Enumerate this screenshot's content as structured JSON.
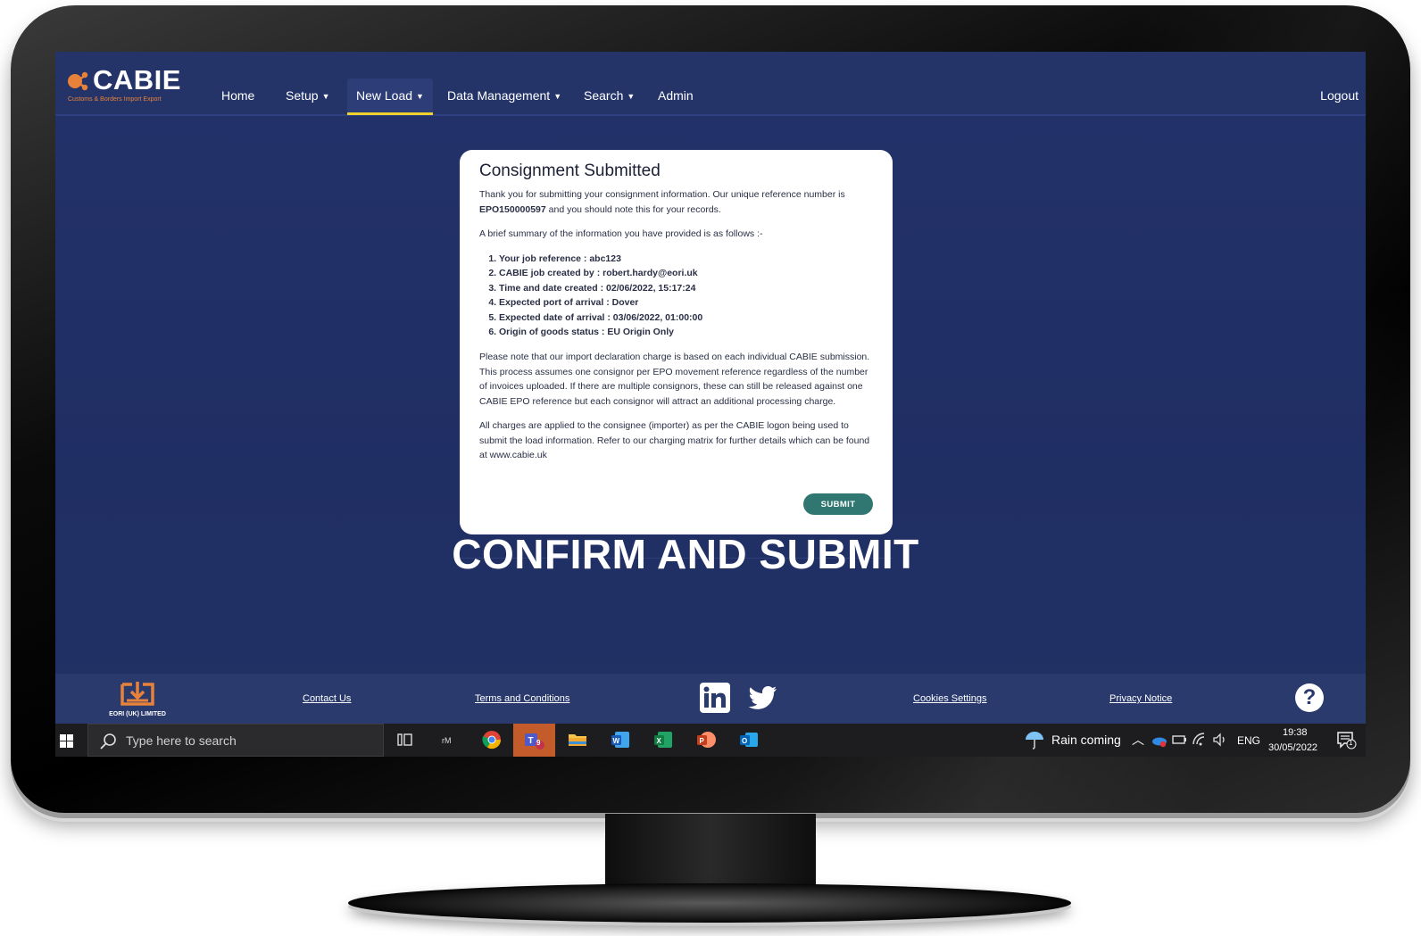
{
  "app": {
    "logo_text": "CABIE",
    "logo_subtitle": "Customs & Borders Import Export"
  },
  "nav": {
    "items": [
      {
        "label": "Home",
        "dropdown": false
      },
      {
        "label": "Setup",
        "dropdown": true
      },
      {
        "label": "New Load",
        "dropdown": true,
        "active": true
      },
      {
        "label": "Data Management",
        "dropdown": true
      },
      {
        "label": "Search",
        "dropdown": true
      },
      {
        "label": "Admin",
        "dropdown": false
      }
    ],
    "logout": "Logout"
  },
  "card": {
    "title": "Consignment Submitted",
    "intro_before": "Thank you for submitting your consignment information. Our unique reference number is ",
    "reference": "EPO150000597",
    "intro_after": " and you should note this for your records.",
    "summary_intro": "A brief summary of the information you have provided is as follows :-",
    "summary_items": [
      "Your job reference : abc123",
      "CABIE job created by : robert.hardy@eori.uk",
      "Time and date created : 02/06/2022, 15:17:24",
      "Expected port of arrival : Dover",
      "Expected date of arrival : 03/06/2022, 01:00:00",
      "Origin of goods status : EU Origin Only"
    ],
    "note_1": "Please note that our import declaration charge is based on each individual CABIE submission. This process assumes one consignor per EPO movement reference regardless of the number of invoices uploaded. If there are multiple consignors, these can still be released against one CABIE EPO reference but each consignor will attract an additional processing charge.",
    "note_2": "All charges are applied to the consignee (importer) as per the CABIE logon being used to submit the load information. Refer to our charging matrix for further details which can be found at www.cabie.uk",
    "submit_label": "SUBMIT"
  },
  "caption": "CONFIRM AND SUBMIT",
  "footer": {
    "logo_label": "EORI (UK) LIMITED",
    "links": {
      "contact": "Contact Us",
      "terms": "Terms and Conditions",
      "cookies": "Cookies Settings",
      "privacy": "Privacy Notice"
    },
    "social_icons": [
      "linkedin-icon",
      "twitter-icon"
    ],
    "help": "?"
  },
  "taskbar": {
    "search_placeholder": "Type here to search",
    "weather": "Rain coming",
    "language": "ENG",
    "time": "19:38",
    "date": "30/05/2022",
    "teams_badge": "9",
    "notification_count": "1",
    "apps": [
      "task-view-icon",
      "app-icon",
      "chrome-icon",
      "teams-icon",
      "file-explorer-icon",
      "word-icon",
      "excel-icon",
      "powerpoint-icon",
      "outlook-icon"
    ]
  },
  "colors": {
    "screen_bg": "#23326a",
    "nav_active_underline": "#f0d32a",
    "brand_orange": "#e8823a",
    "submit_button": "#2f7770"
  }
}
